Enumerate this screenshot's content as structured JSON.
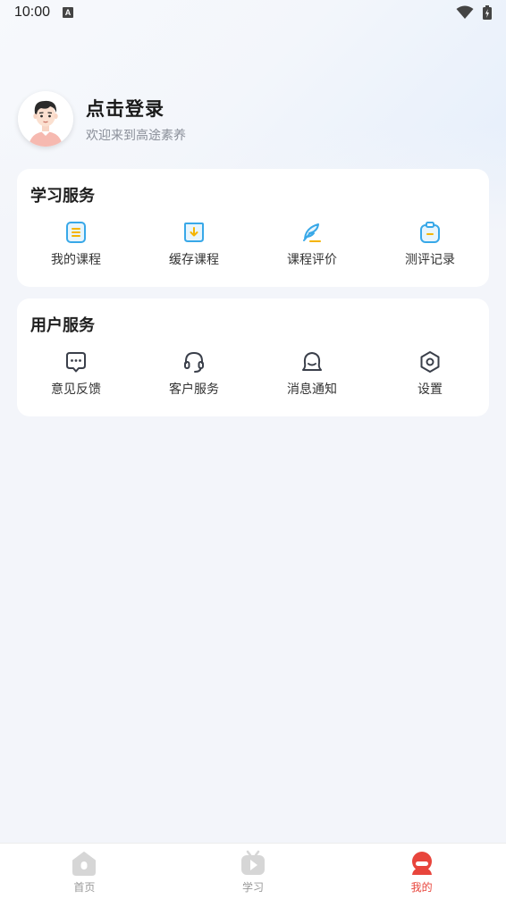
{
  "status_bar": {
    "time": "10:00",
    "notification_badge": "A"
  },
  "profile": {
    "title": "点击登录",
    "subtitle": "欢迎来到高途素养"
  },
  "study_services": {
    "title": "学习服务",
    "items": [
      {
        "label": "我的课程",
        "icon": "course-list-icon"
      },
      {
        "label": "缓存课程",
        "icon": "download-cache-icon"
      },
      {
        "label": "课程评价",
        "icon": "feather-pen-icon"
      },
      {
        "label": "测评记录",
        "icon": "clipboard-icon"
      }
    ]
  },
  "user_services": {
    "title": "用户服务",
    "items": [
      {
        "label": "意见反馈",
        "icon": "chat-bubble-icon"
      },
      {
        "label": "客户服务",
        "icon": "headset-icon"
      },
      {
        "label": "消息通知",
        "icon": "notification-bell-icon"
      },
      {
        "label": "设置",
        "icon": "settings-hexagon-icon"
      }
    ]
  },
  "tabbar": {
    "tabs": [
      {
        "label": "首页",
        "icon": "home-icon",
        "active": false
      },
      {
        "label": "学习",
        "icon": "play-icon",
        "active": false
      },
      {
        "label": "我的",
        "icon": "profile-icon",
        "active": true
      }
    ]
  },
  "colors": {
    "accent_blue": "#38a8e8",
    "accent_yellow": "#f5b400",
    "active_red": "#e8453c",
    "icon_gray": "#3a3f4a"
  }
}
